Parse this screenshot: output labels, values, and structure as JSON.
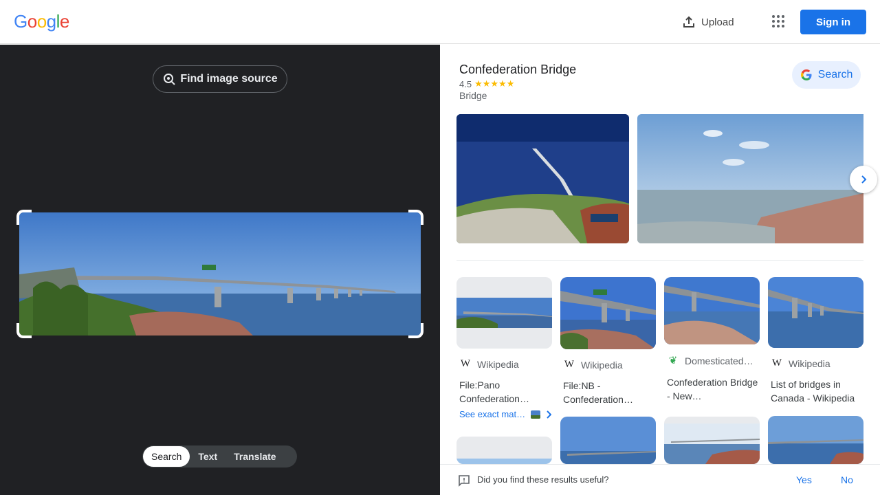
{
  "header": {
    "logo_letters": [
      "G",
      "o",
      "o",
      "g",
      "l",
      "e"
    ],
    "logo_colors": [
      "#4285F4",
      "#EA4335",
      "#FBBC05",
      "#4285F4",
      "#34A853",
      "#EA4335"
    ],
    "upload_label": "Upload",
    "apps_icon": "apps-grid-icon",
    "signin_label": "Sign in"
  },
  "left_panel": {
    "find_source_label": "Find image source",
    "modes": [
      {
        "label": "Search",
        "active": true
      },
      {
        "label": "Text",
        "active": false
      },
      {
        "label": "Translate",
        "active": false
      }
    ]
  },
  "knowledge_panel": {
    "title": "Confederation Bridge",
    "rating": "4.5",
    "stars": "★★★★★",
    "type": "Bridge",
    "search_label": "Search"
  },
  "results": [
    {
      "source": "Wikipedia",
      "source_icon": "W",
      "title": "File:Pano Confederation…"
    },
    {
      "source": "Wikipedia",
      "source_icon": "W",
      "title": "File:NB - Confederation…"
    },
    {
      "source": "Domesticated…",
      "source_icon": "leaf",
      "title": "Confederation Bridge - New…"
    },
    {
      "source": "Wikipedia",
      "source_icon": "W",
      "title": "List of bridges in Canada - Wikipedia"
    }
  ],
  "see_exact_label": "See exact mat…",
  "feedback": {
    "question": "Did you find these results useful?",
    "yes": "Yes",
    "no": "No"
  },
  "colors": {
    "accent": "#1a73e8",
    "dark_bg": "#202124"
  }
}
